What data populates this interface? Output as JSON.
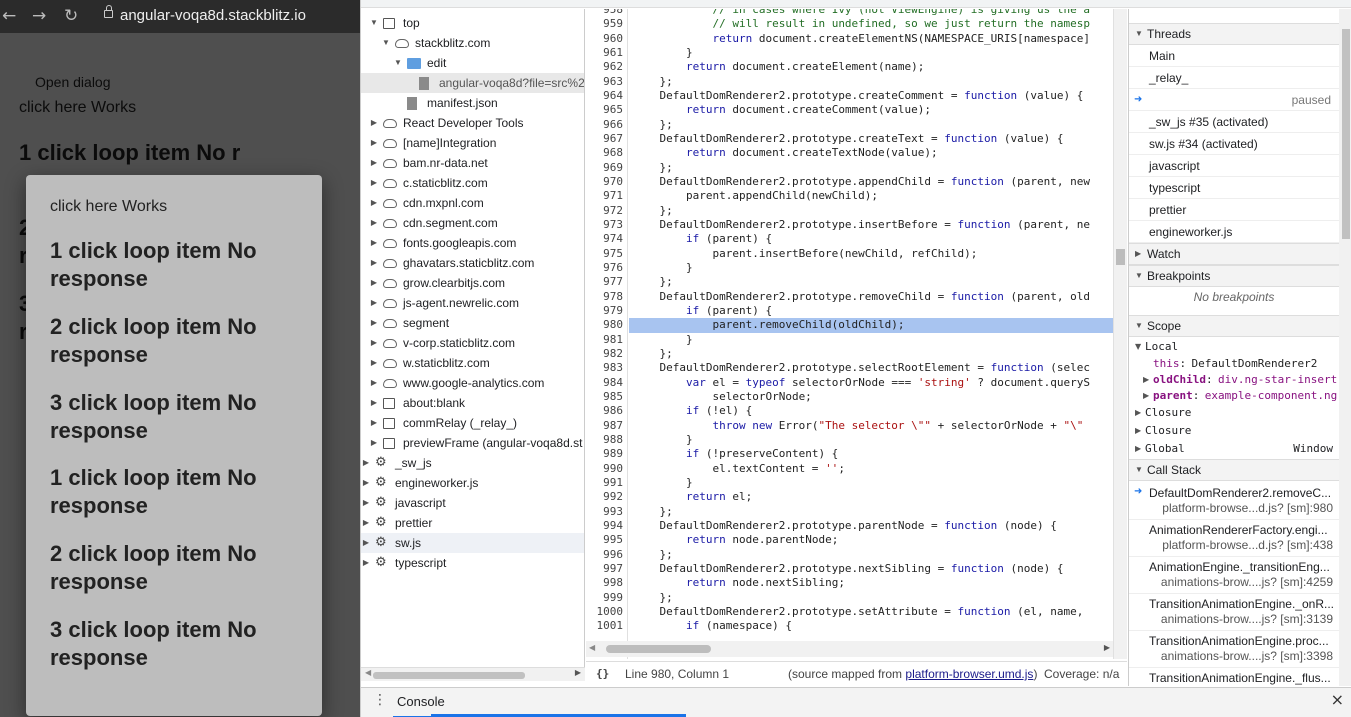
{
  "browser": {
    "back_icon": "←",
    "forward_icon": "→",
    "reload_icon": "↻",
    "url": "angular-voqa8d.stackblitz.io"
  },
  "page": {
    "open_dialog": "Open dialog",
    "click_here": "click here Works",
    "items_behind": [
      "1 click loop item No r",
      "2",
      "r",
      "3",
      "r"
    ]
  },
  "dialog": {
    "click_here": "click here Works",
    "items": [
      "1 click loop item No response",
      "2 click loop item No response",
      "3 click loop item No response",
      "1 click loop item No response",
      "2 click loop item No response",
      "3 click loop item No response"
    ]
  },
  "navigator": {
    "items": [
      {
        "label": "top",
        "icon": "frame-icon"
      },
      {
        "label": "stackblitz.com",
        "icon": "cloud-icon"
      },
      {
        "label": "edit",
        "icon": "folder-icon"
      },
      {
        "label": "angular-voqa8d?file=src%2F",
        "icon": "file-icon"
      },
      {
        "label": "manifest.json",
        "icon": "file-icon"
      },
      {
        "label": "React Developer Tools",
        "icon": "cloud-icon"
      },
      {
        "label": "[name]Integration",
        "icon": "cloud-icon"
      },
      {
        "label": "bam.nr-data.net",
        "icon": "cloud-icon"
      },
      {
        "label": "c.staticblitz.com",
        "icon": "cloud-icon"
      },
      {
        "label": "cdn.mxpnl.com",
        "icon": "cloud-icon"
      },
      {
        "label": "cdn.segment.com",
        "icon": "cloud-icon"
      },
      {
        "label": "fonts.googleapis.com",
        "icon": "cloud-icon"
      },
      {
        "label": "ghavatars.staticblitz.com",
        "icon": "cloud-icon"
      },
      {
        "label": "grow.clearbitjs.com",
        "icon": "cloud-icon"
      },
      {
        "label": "js-agent.newrelic.com",
        "icon": "cloud-icon"
      },
      {
        "label": "segment",
        "icon": "cloud-icon"
      },
      {
        "label": "v-corp.staticblitz.com",
        "icon": "cloud-icon"
      },
      {
        "label": "w.staticblitz.com",
        "icon": "cloud-icon"
      },
      {
        "label": "www.google-analytics.com",
        "icon": "cloud-icon"
      },
      {
        "label": "about:blank",
        "icon": "frame-icon"
      },
      {
        "label": "commRelay (_relay_)",
        "icon": "frame-icon"
      },
      {
        "label": "previewFrame (angular-voqa8d.st",
        "icon": "frame-icon"
      },
      {
        "label": "_sw_js",
        "icon": "gear-icon"
      },
      {
        "label": "engineworker.js",
        "icon": "gear-icon"
      },
      {
        "label": "javascript",
        "icon": "gear-icon"
      },
      {
        "label": "prettier",
        "icon": "gear-icon"
      },
      {
        "label": "sw.js",
        "icon": "gear-icon"
      },
      {
        "label": "typescript",
        "icon": "gear-icon"
      }
    ]
  },
  "code": {
    "line_numbers": [
      "958",
      "959",
      "960",
      "961",
      "962",
      "963",
      "964",
      "965",
      "966",
      "967",
      "968",
      "969",
      "970",
      "971",
      "972",
      "973",
      "974",
      "975",
      "976",
      "977",
      "978",
      "979",
      "980",
      "981",
      "982",
      "983",
      "984",
      "985",
      "986",
      "987",
      "988",
      "989",
      "990",
      "991",
      "992",
      "993",
      "994",
      "995",
      "996",
      "997",
      "998",
      "999",
      "1000",
      "1001"
    ],
    "highlight_line": "980"
  },
  "status": {
    "brackets": "{}",
    "position": "Line 980, Column 1",
    "source_prefix": "(source mapped from ",
    "source_link": "platform-browser.umd.js",
    "source_suffix": ")",
    "coverage": "Coverage: n/a"
  },
  "sidebar": {
    "threads_title": "Threads",
    "threads": [
      {
        "label": "Main",
        "paused": ""
      },
      {
        "label": "_relay_",
        "paused": ""
      },
      {
        "label": "",
        "paused": "paused"
      },
      {
        "label": "_sw_js #35 (activated)",
        "paused": ""
      },
      {
        "label": "sw.js #34 (activated)",
        "paused": ""
      },
      {
        "label": "javascript",
        "paused": ""
      },
      {
        "label": "typescript",
        "paused": ""
      },
      {
        "label": "prettier",
        "paused": ""
      },
      {
        "label": "engineworker.js",
        "paused": ""
      }
    ],
    "watch_title": "Watch",
    "breakpoints_title": "Breakpoints",
    "no_breakpoints": "No breakpoints",
    "scope_title": "Scope",
    "local_label": "Local",
    "scope_vars": [
      {
        "name": "this",
        "value": "DefaultDomRenderer2"
      },
      {
        "name": "oldChild",
        "value": "div.ng-star-insert"
      },
      {
        "name": "parent",
        "value": "example-component.ng"
      }
    ],
    "closure1": "Closure",
    "closure2": "Closure",
    "global_label": "Global",
    "global_value": "Window",
    "callstack_title": "Call Stack",
    "callstack": [
      {
        "fn": "DefaultDomRenderer2.removeC...",
        "loc": "platform-browse...d.js? [sm]:980"
      },
      {
        "fn": "AnimationRendererFactory.engi...",
        "loc": "platform-browse...d.js? [sm]:438"
      },
      {
        "fn": "AnimationEngine._transitionEng...",
        "loc": "animations-brow....js? [sm]:4259"
      },
      {
        "fn": "TransitionAnimationEngine._onR...",
        "loc": "animations-brow....js? [sm]:3139"
      },
      {
        "fn": "TransitionAnimationEngine.proc...",
        "loc": "animations-brow....js? [sm]:3398"
      },
      {
        "fn": "TransitionAnimationEngine._flus...",
        "loc": ""
      }
    ]
  },
  "drawer": {
    "console_tab": "Console",
    "close_icon": "×"
  }
}
